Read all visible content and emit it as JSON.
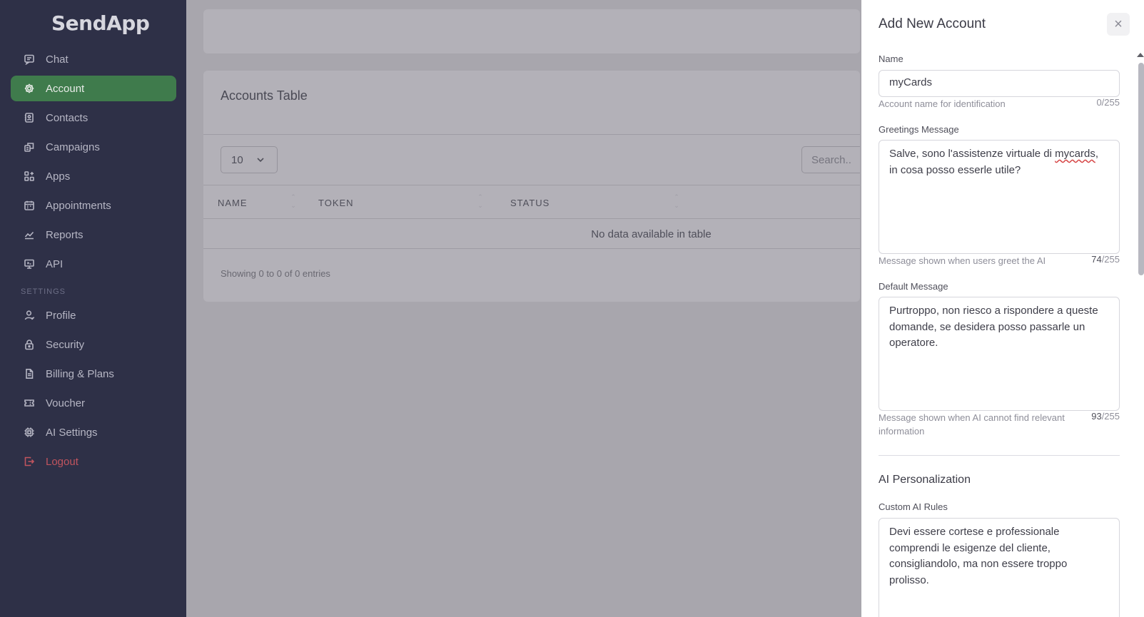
{
  "app": {
    "logo": "SendApp"
  },
  "sidebar": {
    "items": [
      {
        "label": "Chat",
        "icon": "chat-icon"
      },
      {
        "label": "Account",
        "icon": "gear-icon",
        "active": true
      },
      {
        "label": "Contacts",
        "icon": "contacts-icon"
      },
      {
        "label": "Campaigns",
        "icon": "campaigns-icon"
      },
      {
        "label": "Apps",
        "icon": "apps-icon"
      },
      {
        "label": "Appointments",
        "icon": "calendar-icon"
      },
      {
        "label": "Reports",
        "icon": "chart-icon"
      },
      {
        "label": "API",
        "icon": "monitor-icon"
      }
    ],
    "settings_header": "SETTINGS",
    "settings_items": [
      {
        "label": "Profile",
        "icon": "user-icon"
      },
      {
        "label": "Security",
        "icon": "lock-icon"
      },
      {
        "label": "Billing & Plans",
        "icon": "document-icon"
      },
      {
        "label": "Voucher",
        "icon": "ticket-icon"
      },
      {
        "label": "AI Settings",
        "icon": "chip-icon"
      },
      {
        "label": "Logout",
        "icon": "logout-icon"
      }
    ]
  },
  "main": {
    "card_title": "Accounts Table",
    "page_size": "10",
    "search_placeholder": "Search..",
    "columns": [
      "NAME",
      "TOKEN",
      "STATUS"
    ],
    "empty_text": "No data available in table",
    "footer_text": "Showing 0 to 0 of 0 entries"
  },
  "drawer": {
    "title": "Add New Account",
    "close_symbol": "×",
    "name": {
      "label": "Name",
      "value": "myCards",
      "help": "Account name for identification",
      "counter": "0/255"
    },
    "greetings": {
      "label": "Greetings Message",
      "value_before": "Salve, sono l'assistenze virtuale di ",
      "value_misspelled": "mycards",
      "value_after": ",\nin cosa posso esserle utile?",
      "help": "Message shown when users greet the AI",
      "counter_count": "74",
      "counter_max": "/255"
    },
    "default_message": {
      "label": "Default Message",
      "value": "Purtroppo, non riesco a rispondere a queste\ndomande, se desidera posso passarle un\noperatore.",
      "help": "Message shown when AI cannot find relevant information",
      "counter_count": "93",
      "counter_max": "/255"
    },
    "section_title": "AI Personalization",
    "custom_rules": {
      "label": "Custom AI Rules",
      "value": "Devi essere cortese e professionale\ncomprendi le esigenze del cliente,\nconsigliandolo, ma non essere troppo\nprolisso."
    }
  }
}
